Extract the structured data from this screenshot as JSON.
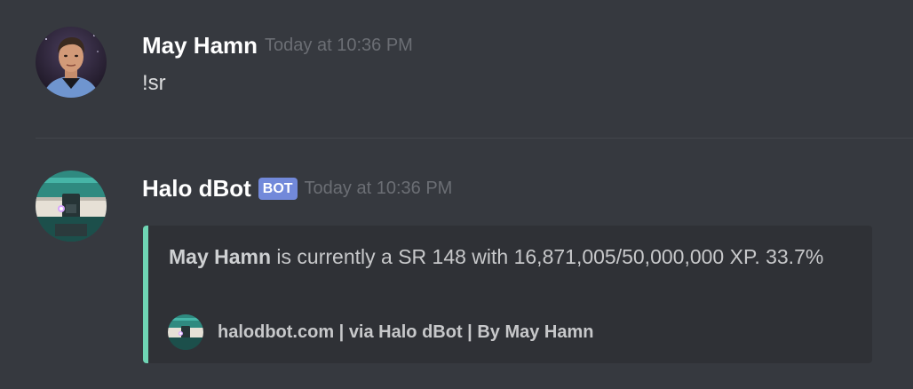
{
  "messages": [
    {
      "author": "May Hamn",
      "timestamp": "Today at 10:36 PM",
      "text": "!sr",
      "avatar_icon": "user-portrait-avatar"
    },
    {
      "author": "Halo dBot",
      "badge": "BOT",
      "timestamp": "Today at 10:36 PM",
      "avatar_icon": "halo-helmet-avatar",
      "embed": {
        "accent_color": "#6fd5b4",
        "description_mention": "May Hamn",
        "description_rest": " is currently a SR 148 with 16,871,005/50,000,000 XP. 33.7%",
        "footer_text": "halodbot.com | via Halo dBot | By May Hamn",
        "footer_icon": "halo-helmet-icon"
      }
    }
  ],
  "colors": {
    "background": "#36393f",
    "embed_background": "#2f3136",
    "bot_badge": "#7289da",
    "username": "#ffffff",
    "timestamp": "#6b6e74"
  }
}
